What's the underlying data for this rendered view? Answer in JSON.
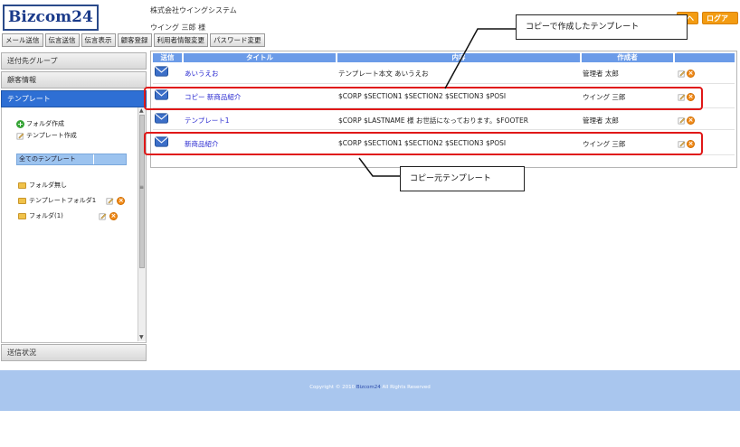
{
  "header": {
    "logo": "Bizcom24",
    "company": "株式会社ウイングシステム",
    "user": "ウイング  三郎  様",
    "help_label": "ヘルプ",
    "logout_label": "ログアウト"
  },
  "nav": {
    "items": [
      {
        "label": "メール送信"
      },
      {
        "label": "伝言送信"
      },
      {
        "label": "伝言表示"
      },
      {
        "label": "顧客登録"
      },
      {
        "label": "利用者情報変更"
      },
      {
        "label": "パスワード変更"
      }
    ]
  },
  "sidebar": {
    "sections": [
      {
        "label": "送付先グループ"
      },
      {
        "label": "顧客情報"
      },
      {
        "label": "テンプレート"
      },
      {
        "label": "送信状況"
      }
    ],
    "create_folder": "フォルダ作成",
    "create_template": "テンプレート作成",
    "all_templates": "全てのテンプレート",
    "folders": [
      {
        "label": "フォルダ無し",
        "actions": false
      },
      {
        "label": "テンプレートフォルダ1",
        "actions": true
      },
      {
        "label": "フォルダ(1)",
        "actions": true
      }
    ]
  },
  "table": {
    "columns": [
      "送信",
      "タイトル",
      "内容",
      "作成者"
    ],
    "rows": [
      {
        "title": "あいうえお",
        "content": "テンプレート本文 あいうえお",
        "author": "管理者  太郎"
      },
      {
        "title": "コピー  新商品紹介",
        "content": "$CORP   $SECTION1    $SECTION2     $SECTION3        $POSI",
        "author": "ウイング  三郎"
      },
      {
        "title": "テンプレート1",
        "content": "$CORP   $LASTNAME  様 お世話になっております。$FOOTER",
        "author": "管理者  太郎"
      },
      {
        "title": "新商品紹介",
        "content": "$CORP   $SECTION1    $SECTION2     $SECTION3        $POSI",
        "author": "ウイング  三郎"
      }
    ]
  },
  "callouts": {
    "copy_created": "コピーで作成したテンプレート",
    "copy_source": "コピー元テンプレート"
  },
  "footer": {
    "copyright_pre": "Copyright © 2010 ",
    "brand": "Bizcom24",
    "copyright_post": " All Rights Reserved"
  },
  "colors": {
    "accent_orange": "#f39c12",
    "header_blue": "#6b9be8",
    "active_blue": "#2e6fd4",
    "highlight_red": "#e01818",
    "footer_blue": "#a9c6ee"
  }
}
